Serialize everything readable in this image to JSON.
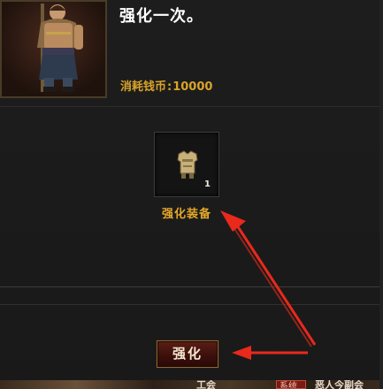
{
  "dialog": {
    "title": "强化一次。",
    "cost_label": "消耗钱币",
    "cost_separator": ":",
    "cost_value": "10000"
  },
  "item_slot": {
    "icon": "armor-chest-icon",
    "count": "1",
    "label": "强化装备"
  },
  "actions": {
    "strengthen_label": "强化"
  },
  "bottom_strip": {
    "text_left": "工会",
    "badge": "系统",
    "text_right": "恶人今副会"
  },
  "colors": {
    "gold_text": "#e6a82a",
    "button_red": "#5a1e16",
    "annotation_arrow": "#e8291c"
  }
}
